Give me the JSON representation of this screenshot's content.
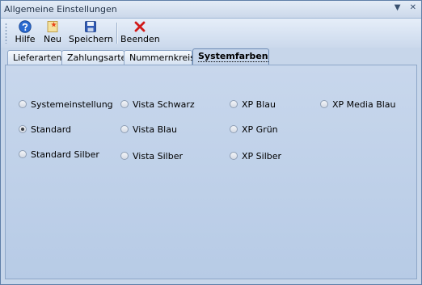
{
  "window": {
    "title": "Allgemeine Einstellungen",
    "buttons": [
      "▼",
      "✕"
    ]
  },
  "toolbar": {
    "help_label": "Hilfe",
    "new_label": "Neu",
    "save_label": "Speichern",
    "exit_label": "Beenden"
  },
  "tabs": [
    {
      "label": "Lieferarten"
    },
    {
      "label": "Zahlungsarten"
    },
    {
      "label": "Nummernkreise"
    },
    {
      "label": "Systemfarben",
      "active": true
    }
  ],
  "themes": {
    "options": [
      {
        "label": "Systemeinstellung",
        "checked": false
      },
      {
        "label": "Standard",
        "checked": true
      },
      {
        "label": "Standard Silber",
        "checked": false
      },
      {
        "label": "Vista Schwarz",
        "checked": false
      },
      {
        "label": "Vista Blau",
        "checked": false
      },
      {
        "label": "Vista Silber",
        "checked": false
      },
      {
        "label": "XP Blau",
        "checked": false
      },
      {
        "label": "XP Grün",
        "checked": false
      },
      {
        "label": "XP Silber",
        "checked": false
      },
      {
        "label": "XP Media Blau",
        "checked": false
      }
    ]
  },
  "icons": {
    "help": "help-icon",
    "new": "new-document-icon",
    "save": "save-disk-icon",
    "exit": "close-x-icon"
  },
  "colors": {
    "background": "#c7d6ea",
    "accent": "#1f5bbf",
    "exit_red": "#d11a1a"
  }
}
